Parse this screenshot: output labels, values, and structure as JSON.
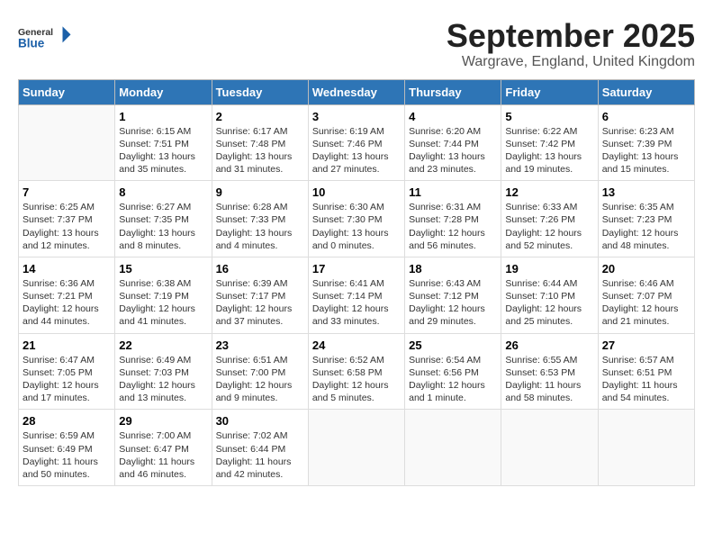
{
  "logo": {
    "general": "General",
    "blue": "Blue"
  },
  "header": {
    "month": "September 2025",
    "location": "Wargrave, England, United Kingdom"
  },
  "days_of_week": [
    "Sunday",
    "Monday",
    "Tuesday",
    "Wednesday",
    "Thursday",
    "Friday",
    "Saturday"
  ],
  "weeks": [
    [
      {
        "num": "",
        "sunrise": "",
        "sunset": "",
        "daylight": ""
      },
      {
        "num": "1",
        "sunrise": "Sunrise: 6:15 AM",
        "sunset": "Sunset: 7:51 PM",
        "daylight": "Daylight: 13 hours and 35 minutes."
      },
      {
        "num": "2",
        "sunrise": "Sunrise: 6:17 AM",
        "sunset": "Sunset: 7:48 PM",
        "daylight": "Daylight: 13 hours and 31 minutes."
      },
      {
        "num": "3",
        "sunrise": "Sunrise: 6:19 AM",
        "sunset": "Sunset: 7:46 PM",
        "daylight": "Daylight: 13 hours and 27 minutes."
      },
      {
        "num": "4",
        "sunrise": "Sunrise: 6:20 AM",
        "sunset": "Sunset: 7:44 PM",
        "daylight": "Daylight: 13 hours and 23 minutes."
      },
      {
        "num": "5",
        "sunrise": "Sunrise: 6:22 AM",
        "sunset": "Sunset: 7:42 PM",
        "daylight": "Daylight: 13 hours and 19 minutes."
      },
      {
        "num": "6",
        "sunrise": "Sunrise: 6:23 AM",
        "sunset": "Sunset: 7:39 PM",
        "daylight": "Daylight: 13 hours and 15 minutes."
      }
    ],
    [
      {
        "num": "7",
        "sunrise": "Sunrise: 6:25 AM",
        "sunset": "Sunset: 7:37 PM",
        "daylight": "Daylight: 13 hours and 12 minutes."
      },
      {
        "num": "8",
        "sunrise": "Sunrise: 6:27 AM",
        "sunset": "Sunset: 7:35 PM",
        "daylight": "Daylight: 13 hours and 8 minutes."
      },
      {
        "num": "9",
        "sunrise": "Sunrise: 6:28 AM",
        "sunset": "Sunset: 7:33 PM",
        "daylight": "Daylight: 13 hours and 4 minutes."
      },
      {
        "num": "10",
        "sunrise": "Sunrise: 6:30 AM",
        "sunset": "Sunset: 7:30 PM",
        "daylight": "Daylight: 13 hours and 0 minutes."
      },
      {
        "num": "11",
        "sunrise": "Sunrise: 6:31 AM",
        "sunset": "Sunset: 7:28 PM",
        "daylight": "Daylight: 12 hours and 56 minutes."
      },
      {
        "num": "12",
        "sunrise": "Sunrise: 6:33 AM",
        "sunset": "Sunset: 7:26 PM",
        "daylight": "Daylight: 12 hours and 52 minutes."
      },
      {
        "num": "13",
        "sunrise": "Sunrise: 6:35 AM",
        "sunset": "Sunset: 7:23 PM",
        "daylight": "Daylight: 12 hours and 48 minutes."
      }
    ],
    [
      {
        "num": "14",
        "sunrise": "Sunrise: 6:36 AM",
        "sunset": "Sunset: 7:21 PM",
        "daylight": "Daylight: 12 hours and 44 minutes."
      },
      {
        "num": "15",
        "sunrise": "Sunrise: 6:38 AM",
        "sunset": "Sunset: 7:19 PM",
        "daylight": "Daylight: 12 hours and 41 minutes."
      },
      {
        "num": "16",
        "sunrise": "Sunrise: 6:39 AM",
        "sunset": "Sunset: 7:17 PM",
        "daylight": "Daylight: 12 hours and 37 minutes."
      },
      {
        "num": "17",
        "sunrise": "Sunrise: 6:41 AM",
        "sunset": "Sunset: 7:14 PM",
        "daylight": "Daylight: 12 hours and 33 minutes."
      },
      {
        "num": "18",
        "sunrise": "Sunrise: 6:43 AM",
        "sunset": "Sunset: 7:12 PM",
        "daylight": "Daylight: 12 hours and 29 minutes."
      },
      {
        "num": "19",
        "sunrise": "Sunrise: 6:44 AM",
        "sunset": "Sunset: 7:10 PM",
        "daylight": "Daylight: 12 hours and 25 minutes."
      },
      {
        "num": "20",
        "sunrise": "Sunrise: 6:46 AM",
        "sunset": "Sunset: 7:07 PM",
        "daylight": "Daylight: 12 hours and 21 minutes."
      }
    ],
    [
      {
        "num": "21",
        "sunrise": "Sunrise: 6:47 AM",
        "sunset": "Sunset: 7:05 PM",
        "daylight": "Daylight: 12 hours and 17 minutes."
      },
      {
        "num": "22",
        "sunrise": "Sunrise: 6:49 AM",
        "sunset": "Sunset: 7:03 PM",
        "daylight": "Daylight: 12 hours and 13 minutes."
      },
      {
        "num": "23",
        "sunrise": "Sunrise: 6:51 AM",
        "sunset": "Sunset: 7:00 PM",
        "daylight": "Daylight: 12 hours and 9 minutes."
      },
      {
        "num": "24",
        "sunrise": "Sunrise: 6:52 AM",
        "sunset": "Sunset: 6:58 PM",
        "daylight": "Daylight: 12 hours and 5 minutes."
      },
      {
        "num": "25",
        "sunrise": "Sunrise: 6:54 AM",
        "sunset": "Sunset: 6:56 PM",
        "daylight": "Daylight: 12 hours and 1 minute."
      },
      {
        "num": "26",
        "sunrise": "Sunrise: 6:55 AM",
        "sunset": "Sunset: 6:53 PM",
        "daylight": "Daylight: 11 hours and 58 minutes."
      },
      {
        "num": "27",
        "sunrise": "Sunrise: 6:57 AM",
        "sunset": "Sunset: 6:51 PM",
        "daylight": "Daylight: 11 hours and 54 minutes."
      }
    ],
    [
      {
        "num": "28",
        "sunrise": "Sunrise: 6:59 AM",
        "sunset": "Sunset: 6:49 PM",
        "daylight": "Daylight: 11 hours and 50 minutes."
      },
      {
        "num": "29",
        "sunrise": "Sunrise: 7:00 AM",
        "sunset": "Sunset: 6:47 PM",
        "daylight": "Daylight: 11 hours and 46 minutes."
      },
      {
        "num": "30",
        "sunrise": "Sunrise: 7:02 AM",
        "sunset": "Sunset: 6:44 PM",
        "daylight": "Daylight: 11 hours and 42 minutes."
      },
      {
        "num": "",
        "sunrise": "",
        "sunset": "",
        "daylight": ""
      },
      {
        "num": "",
        "sunrise": "",
        "sunset": "",
        "daylight": ""
      },
      {
        "num": "",
        "sunrise": "",
        "sunset": "",
        "daylight": ""
      },
      {
        "num": "",
        "sunrise": "",
        "sunset": "",
        "daylight": ""
      }
    ]
  ]
}
